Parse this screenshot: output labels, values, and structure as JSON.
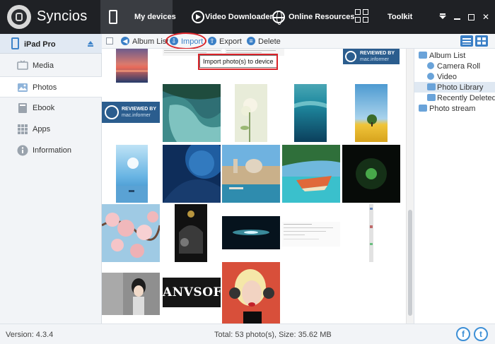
{
  "app": {
    "name": "Syncios"
  },
  "nav": {
    "tabs": [
      {
        "label": "My devices",
        "active": true
      },
      {
        "label": "Video Downloader"
      },
      {
        "label": "Online Resources"
      },
      {
        "label": "Toolkit"
      }
    ]
  },
  "sidebar": {
    "device": "iPad Pro",
    "items": [
      {
        "label": "Media",
        "icon": "tv-icon"
      },
      {
        "label": "Photos",
        "icon": "photo-icon",
        "active": true
      },
      {
        "label": "Ebook",
        "icon": "book-icon"
      },
      {
        "label": "Apps",
        "icon": "apps-grid-icon"
      },
      {
        "label": "Information",
        "icon": "info-icon"
      }
    ]
  },
  "toolbar": {
    "album_list": "Album List",
    "import": "Import",
    "export": "Export",
    "delete": "Delete"
  },
  "tooltip": "Import photo(s) to device",
  "watermark": {
    "line1": "REVIEWED BY",
    "line2": "mac.informer"
  },
  "anvsoft": "ANVSOFT",
  "albums": [
    {
      "label": "Album List",
      "level": 0
    },
    {
      "label": "Camera Roll",
      "level": 1
    },
    {
      "label": "Video",
      "level": 1
    },
    {
      "label": "Photo Library",
      "level": 1,
      "selected": true
    },
    {
      "label": "Recently Deleted",
      "level": 1
    },
    {
      "label": "Photo stream",
      "level": 0
    }
  ],
  "status": {
    "version": "Version: 4.3.4",
    "totals": "Total: 53 photo(s), Size: 35.62 MB"
  },
  "colors": {
    "accent": "#3a7fc6",
    "titlebar": "#1f2125",
    "highlight": "#d9242a"
  }
}
